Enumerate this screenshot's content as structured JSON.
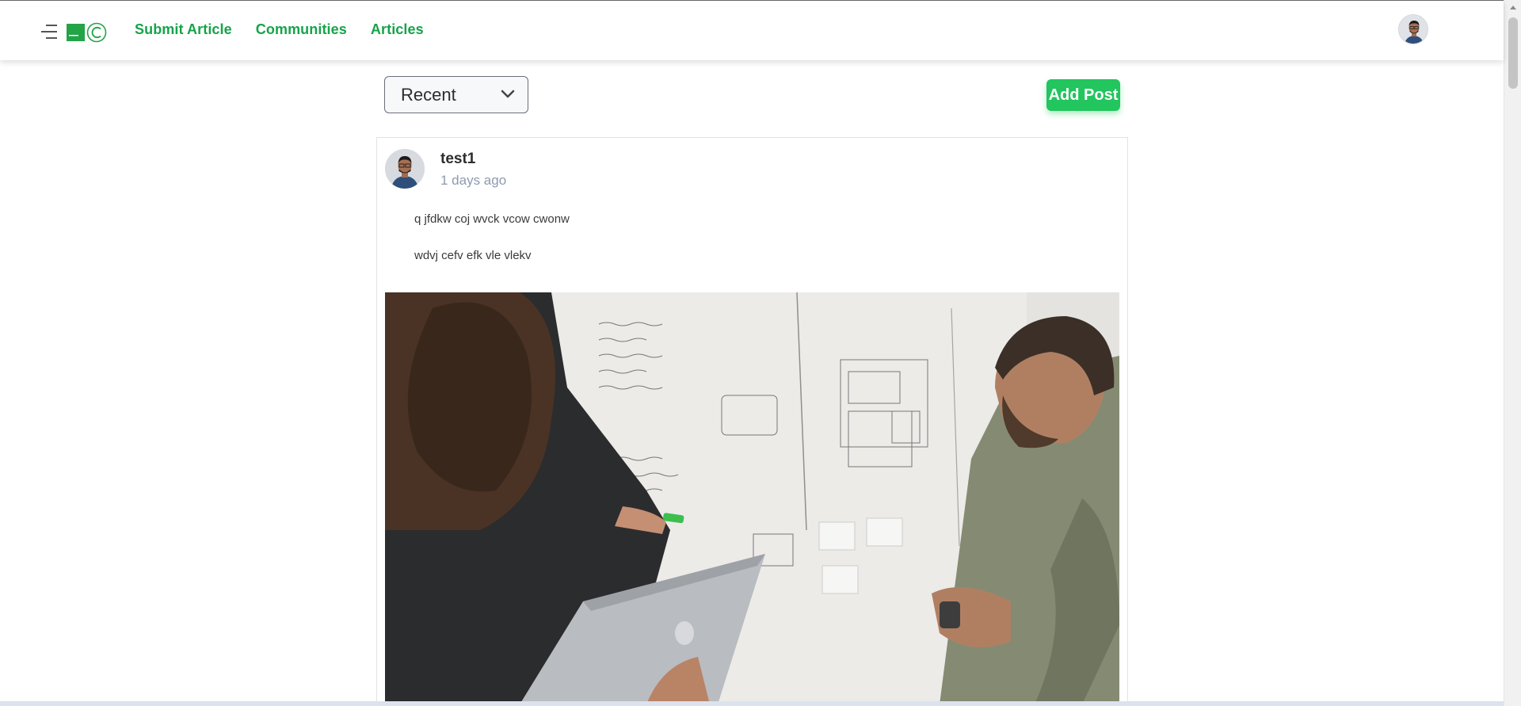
{
  "nav": {
    "links": [
      {
        "label": "Submit Article"
      },
      {
        "label": "Communities"
      },
      {
        "label": "Articles"
      }
    ],
    "accent_color": "#16a34a"
  },
  "toolbar": {
    "sort_selected": "Recent",
    "add_post_label": "Add Post",
    "add_post_color": "#22c55e"
  },
  "post": {
    "username": "test1",
    "time_ago": "1 days ago",
    "lines": [
      "q jfdkw coj wvck vcow cwonw",
      "wdvj cefv efk vle vlekv"
    ]
  },
  "icons": {
    "menu": "hamburger-menu-icon",
    "logo": "site-logo",
    "avatar": "user-avatar",
    "chevron": "chevron-down-icon"
  }
}
